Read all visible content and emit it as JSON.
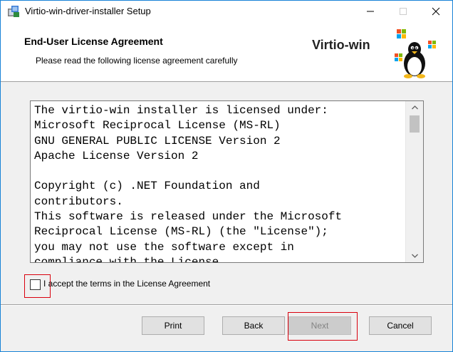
{
  "window": {
    "title": "Virtio-win-driver-installer Setup",
    "controls": {
      "minimize": "—",
      "maximize": "☐",
      "close": "✕"
    }
  },
  "header": {
    "title": "End-User License Agreement",
    "subtitle": "Please read the following license agreement carefully",
    "logo_text": "Virtio-win"
  },
  "license": {
    "text": "The virtio-win installer is licensed under:\nMicrosoft Reciprocal License (MS-RL)\nGNU GENERAL PUBLIC LICENSE Version 2\nApache License Version 2\n\nCopyright (c) .NET Foundation and\ncontributors.\nThis software is released under the Microsoft\nReciprocal License (MS-RL) (the \"License\");\nyou may not use the software except in\ncompliance with the License."
  },
  "accept": {
    "label": "I accept the terms in the License Agreement",
    "checked": false
  },
  "buttons": {
    "print": "Print",
    "back": "Back",
    "next": "Next",
    "cancel": "Cancel"
  },
  "colors": {
    "highlight": "#d9000d",
    "window_border": "#1883d7",
    "disabled_text": "#838383"
  }
}
